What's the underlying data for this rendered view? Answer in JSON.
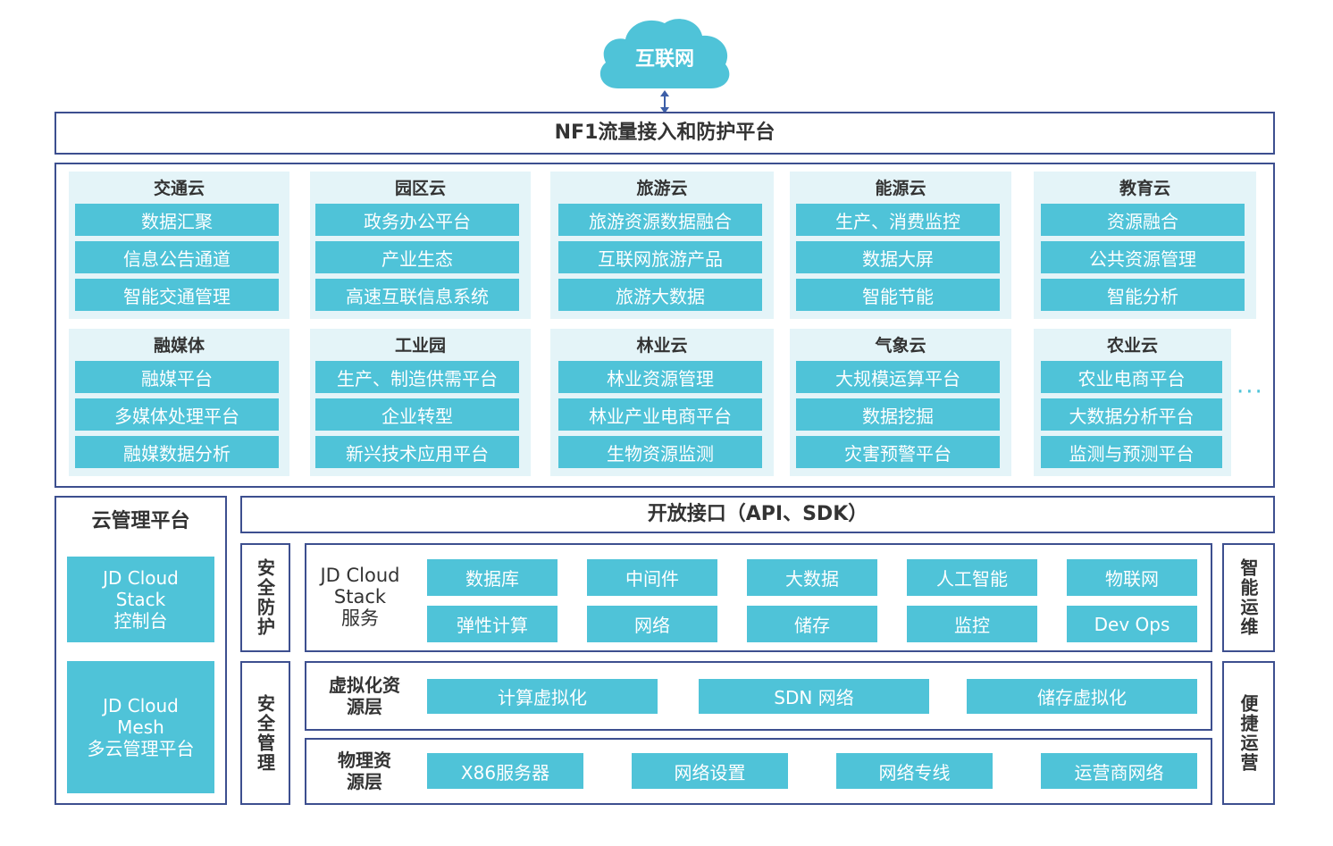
{
  "internet": {
    "label": "互联网"
  },
  "nf1": {
    "label": "NF1流量接入和防护平台"
  },
  "clouds": [
    {
      "title": "交通云",
      "items": [
        "数据汇聚",
        "信息公告通道",
        "智能交通管理"
      ]
    },
    {
      "title": "园区云",
      "items": [
        "政务办公平台",
        "产业生态",
        "高速互联信息系统"
      ]
    },
    {
      "title": "旅游云",
      "items": [
        "旅游资源数据融合",
        "互联网旅游产品",
        "旅游大数据"
      ]
    },
    {
      "title": "能源云",
      "items": [
        "生产、消费监控",
        "数据大屏",
        "智能节能"
      ]
    },
    {
      "title": "教育云",
      "items": [
        "资源融合",
        "公共资源管理",
        "智能分析"
      ]
    },
    {
      "title": "融媒体",
      "items": [
        "融媒平台",
        "多媒体处理平台",
        "融媒数据分析"
      ]
    },
    {
      "title": "工业园",
      "items": [
        "生产、制造供需平台",
        "企业转型",
        "新兴技术应用平台"
      ]
    },
    {
      "title": "林业云",
      "items": [
        "林业资源管理",
        "林业产业电商平台",
        "生物资源监测"
      ]
    },
    {
      "title": "气象云",
      "items": [
        "大规模运算平台",
        "数据挖掘",
        "灾害预警平台"
      ]
    },
    {
      "title": "农业云",
      "items": [
        "农业电商平台",
        "大数据分析平台",
        "监测与预测平台"
      ]
    }
  ],
  "more_dots": "···",
  "cloud_mgmt": {
    "title": "云管理平台",
    "stack_console": "JD Cloud\nStack\n控制台",
    "mesh": "JD Cloud\nMesh\n多云管理平台"
  },
  "open_api": {
    "label": "开放接口（API、SDK）"
  },
  "left_side": {
    "security_protect": "安全防护",
    "security_mgmt": "安全管理"
  },
  "right_side": {
    "smart_ops": "智能运维",
    "easy_ops": "便捷运营"
  },
  "stack_services": {
    "label": "JD Cloud\nStack\n服务",
    "items": [
      "数据库",
      "中间件",
      "大数据",
      "人工智能",
      "物联网",
      "弹性计算",
      "网络",
      "储存",
      "监控",
      "Dev Ops"
    ]
  },
  "virtual_layer": {
    "label": "虚拟化资\n源层",
    "items": [
      "计算虚拟化",
      "SDN 网络",
      "储存虚拟化"
    ]
  },
  "physical_layer": {
    "label": "物理资\n源层",
    "items": [
      "X86服务器",
      "网络设置",
      "网络专线",
      "运营商网络"
    ]
  },
  "colors": {
    "frame": "#3d4f8f",
    "teal": "#4fc3d8",
    "cloud_bg": "#e4f4f8",
    "cloud_shape": "#4fc3d8",
    "arrow": "#3d5fa8"
  }
}
